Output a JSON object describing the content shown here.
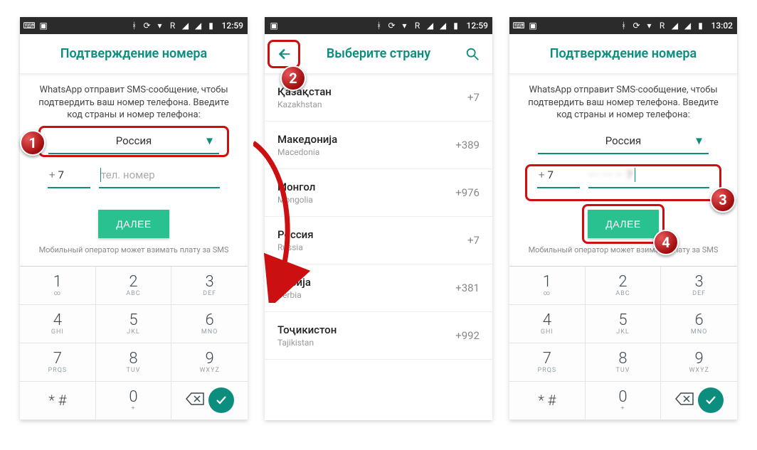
{
  "colors": {
    "accent": "#0b8e7e",
    "button": "#29c18f",
    "highlight": "#cc0f10"
  },
  "statusbar": {
    "time1": "12:59",
    "time2": "12:59",
    "time3": "13:02"
  },
  "confirm": {
    "title": "Подтверждение номера",
    "description": "WhatsApp отправит SMS-сообщение, чтобы подтвердить ваш номер телефона. Введите код страны и номер телефона:",
    "country": "Россия",
    "code": "7",
    "placeholder": "тел. номер",
    "masked_number": "··· ··· ·· 7",
    "next": "ДАЛЕЕ",
    "carrier_note": "Мобильный оператор может взимать плату за SMS"
  },
  "picker": {
    "title": "Выберите страну"
  },
  "countries": [
    {
      "native": "Қазақстан",
      "eng": "Kazakhstan",
      "dial": "+7"
    },
    {
      "native": "Македонија",
      "eng": "Macedonia",
      "dial": "+389"
    },
    {
      "native": "Монгол",
      "eng": "Mongolia",
      "dial": "+976"
    },
    {
      "native": "Россия",
      "eng": "Russia",
      "dial": "+7"
    },
    {
      "native": "Србија",
      "eng": "Serbia",
      "dial": "+381"
    },
    {
      "native": "Тоҷикистон",
      "eng": "Tajikistan",
      "dial": "+992"
    }
  ],
  "keypad": [
    {
      "d": "1",
      "l": "∞"
    },
    {
      "d": "2",
      "l": "ABC"
    },
    {
      "d": "3",
      "l": "DEF"
    },
    {
      "d": "4",
      "l": "GHI"
    },
    {
      "d": "5",
      "l": "JKL"
    },
    {
      "d": "6",
      "l": "MNO"
    },
    {
      "d": "7",
      "l": "PRQS"
    },
    {
      "d": "8",
      "l": "TUV"
    },
    {
      "d": "9",
      "l": "WXYZ"
    },
    {
      "d": "* #",
      "l": ""
    },
    {
      "d": "0",
      "l": "+"
    },
    {
      "d": "",
      "l": ""
    }
  ],
  "badges": {
    "b1": "1",
    "b2": "2",
    "b3": "3",
    "b4": "4"
  }
}
